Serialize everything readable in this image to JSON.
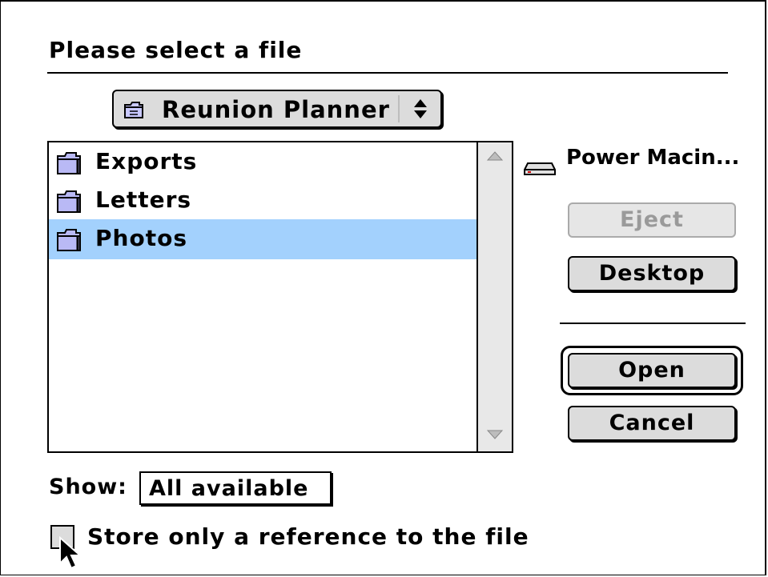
{
  "dialog": {
    "title": "Please select a file"
  },
  "folder_popup": {
    "label": "Reunion Planner",
    "icon": "folder-icon"
  },
  "file_list": {
    "items": [
      {
        "name": "Exports",
        "icon": "folder-icon",
        "selected": false
      },
      {
        "name": "Letters",
        "icon": "folder-icon",
        "selected": false
      },
      {
        "name": "Photos",
        "icon": "folder-icon",
        "selected": true
      }
    ],
    "selection_color": "#a3d1fd"
  },
  "volume": {
    "name": "Power Macin...",
    "icon": "hard-disk-icon"
  },
  "buttons": {
    "eject": "Eject",
    "desktop": "Desktop",
    "open": "Open",
    "cancel": "Cancel"
  },
  "show": {
    "label": "Show:",
    "value": "All available"
  },
  "reference_checkbox": {
    "label": "Store only a reference to the file",
    "checked": false
  }
}
